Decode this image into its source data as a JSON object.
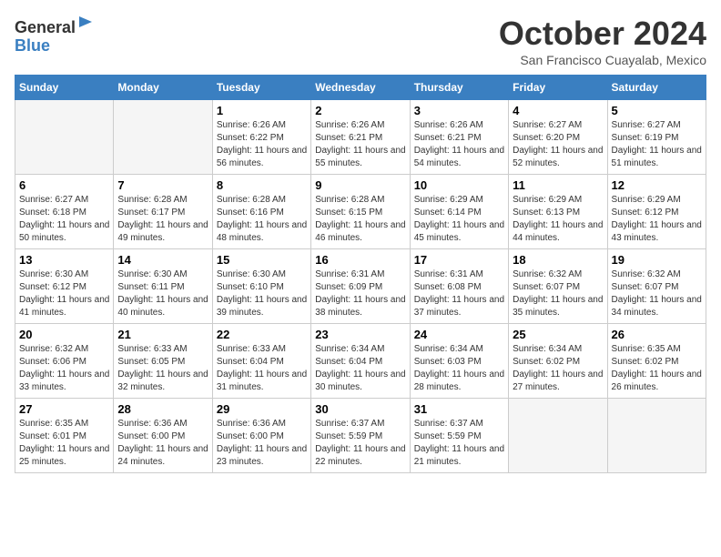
{
  "header": {
    "logo_line1": "General",
    "logo_line2": "Blue",
    "title": "October 2024",
    "subtitle": "San Francisco Cuayalab, Mexico"
  },
  "days_of_week": [
    "Sunday",
    "Monday",
    "Tuesday",
    "Wednesday",
    "Thursday",
    "Friday",
    "Saturday"
  ],
  "weeks": [
    [
      {
        "day": "",
        "sunrise": "",
        "sunset": "",
        "daylight": ""
      },
      {
        "day": "",
        "sunrise": "",
        "sunset": "",
        "daylight": ""
      },
      {
        "day": "1",
        "sunrise": "Sunrise: 6:26 AM",
        "sunset": "Sunset: 6:22 PM",
        "daylight": "Daylight: 11 hours and 56 minutes."
      },
      {
        "day": "2",
        "sunrise": "Sunrise: 6:26 AM",
        "sunset": "Sunset: 6:21 PM",
        "daylight": "Daylight: 11 hours and 55 minutes."
      },
      {
        "day": "3",
        "sunrise": "Sunrise: 6:26 AM",
        "sunset": "Sunset: 6:21 PM",
        "daylight": "Daylight: 11 hours and 54 minutes."
      },
      {
        "day": "4",
        "sunrise": "Sunrise: 6:27 AM",
        "sunset": "Sunset: 6:20 PM",
        "daylight": "Daylight: 11 hours and 52 minutes."
      },
      {
        "day": "5",
        "sunrise": "Sunrise: 6:27 AM",
        "sunset": "Sunset: 6:19 PM",
        "daylight": "Daylight: 11 hours and 51 minutes."
      }
    ],
    [
      {
        "day": "6",
        "sunrise": "Sunrise: 6:27 AM",
        "sunset": "Sunset: 6:18 PM",
        "daylight": "Daylight: 11 hours and 50 minutes."
      },
      {
        "day": "7",
        "sunrise": "Sunrise: 6:28 AM",
        "sunset": "Sunset: 6:17 PM",
        "daylight": "Daylight: 11 hours and 49 minutes."
      },
      {
        "day": "8",
        "sunrise": "Sunrise: 6:28 AM",
        "sunset": "Sunset: 6:16 PM",
        "daylight": "Daylight: 11 hours and 48 minutes."
      },
      {
        "day": "9",
        "sunrise": "Sunrise: 6:28 AM",
        "sunset": "Sunset: 6:15 PM",
        "daylight": "Daylight: 11 hours and 46 minutes."
      },
      {
        "day": "10",
        "sunrise": "Sunrise: 6:29 AM",
        "sunset": "Sunset: 6:14 PM",
        "daylight": "Daylight: 11 hours and 45 minutes."
      },
      {
        "day": "11",
        "sunrise": "Sunrise: 6:29 AM",
        "sunset": "Sunset: 6:13 PM",
        "daylight": "Daylight: 11 hours and 44 minutes."
      },
      {
        "day": "12",
        "sunrise": "Sunrise: 6:29 AM",
        "sunset": "Sunset: 6:12 PM",
        "daylight": "Daylight: 11 hours and 43 minutes."
      }
    ],
    [
      {
        "day": "13",
        "sunrise": "Sunrise: 6:30 AM",
        "sunset": "Sunset: 6:12 PM",
        "daylight": "Daylight: 11 hours and 41 minutes."
      },
      {
        "day": "14",
        "sunrise": "Sunrise: 6:30 AM",
        "sunset": "Sunset: 6:11 PM",
        "daylight": "Daylight: 11 hours and 40 minutes."
      },
      {
        "day": "15",
        "sunrise": "Sunrise: 6:30 AM",
        "sunset": "Sunset: 6:10 PM",
        "daylight": "Daylight: 11 hours and 39 minutes."
      },
      {
        "day": "16",
        "sunrise": "Sunrise: 6:31 AM",
        "sunset": "Sunset: 6:09 PM",
        "daylight": "Daylight: 11 hours and 38 minutes."
      },
      {
        "day": "17",
        "sunrise": "Sunrise: 6:31 AM",
        "sunset": "Sunset: 6:08 PM",
        "daylight": "Daylight: 11 hours and 37 minutes."
      },
      {
        "day": "18",
        "sunrise": "Sunrise: 6:32 AM",
        "sunset": "Sunset: 6:07 PM",
        "daylight": "Daylight: 11 hours and 35 minutes."
      },
      {
        "day": "19",
        "sunrise": "Sunrise: 6:32 AM",
        "sunset": "Sunset: 6:07 PM",
        "daylight": "Daylight: 11 hours and 34 minutes."
      }
    ],
    [
      {
        "day": "20",
        "sunrise": "Sunrise: 6:32 AM",
        "sunset": "Sunset: 6:06 PM",
        "daylight": "Daylight: 11 hours and 33 minutes."
      },
      {
        "day": "21",
        "sunrise": "Sunrise: 6:33 AM",
        "sunset": "Sunset: 6:05 PM",
        "daylight": "Daylight: 11 hours and 32 minutes."
      },
      {
        "day": "22",
        "sunrise": "Sunrise: 6:33 AM",
        "sunset": "Sunset: 6:04 PM",
        "daylight": "Daylight: 11 hours and 31 minutes."
      },
      {
        "day": "23",
        "sunrise": "Sunrise: 6:34 AM",
        "sunset": "Sunset: 6:04 PM",
        "daylight": "Daylight: 11 hours and 30 minutes."
      },
      {
        "day": "24",
        "sunrise": "Sunrise: 6:34 AM",
        "sunset": "Sunset: 6:03 PM",
        "daylight": "Daylight: 11 hours and 28 minutes."
      },
      {
        "day": "25",
        "sunrise": "Sunrise: 6:34 AM",
        "sunset": "Sunset: 6:02 PM",
        "daylight": "Daylight: 11 hours and 27 minutes."
      },
      {
        "day": "26",
        "sunrise": "Sunrise: 6:35 AM",
        "sunset": "Sunset: 6:02 PM",
        "daylight": "Daylight: 11 hours and 26 minutes."
      }
    ],
    [
      {
        "day": "27",
        "sunrise": "Sunrise: 6:35 AM",
        "sunset": "Sunset: 6:01 PM",
        "daylight": "Daylight: 11 hours and 25 minutes."
      },
      {
        "day": "28",
        "sunrise": "Sunrise: 6:36 AM",
        "sunset": "Sunset: 6:00 PM",
        "daylight": "Daylight: 11 hours and 24 minutes."
      },
      {
        "day": "29",
        "sunrise": "Sunrise: 6:36 AM",
        "sunset": "Sunset: 6:00 PM",
        "daylight": "Daylight: 11 hours and 23 minutes."
      },
      {
        "day": "30",
        "sunrise": "Sunrise: 6:37 AM",
        "sunset": "Sunset: 5:59 PM",
        "daylight": "Daylight: 11 hours and 22 minutes."
      },
      {
        "day": "31",
        "sunrise": "Sunrise: 6:37 AM",
        "sunset": "Sunset: 5:59 PM",
        "daylight": "Daylight: 11 hours and 21 minutes."
      },
      {
        "day": "",
        "sunrise": "",
        "sunset": "",
        "daylight": ""
      },
      {
        "day": "",
        "sunrise": "",
        "sunset": "",
        "daylight": ""
      }
    ]
  ]
}
